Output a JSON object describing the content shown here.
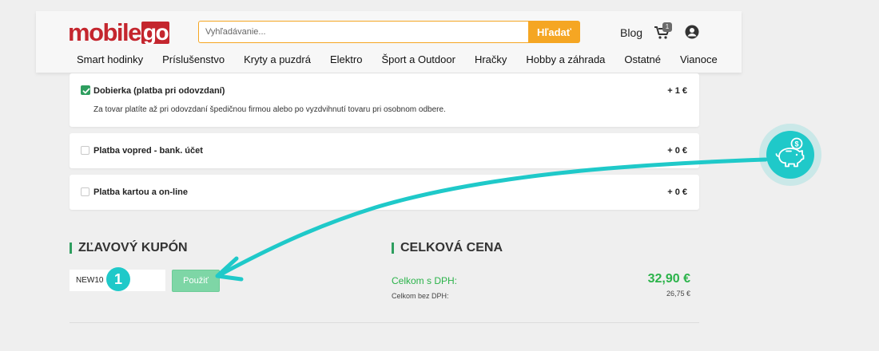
{
  "header": {
    "logo_text": "mobile",
    "logo_box": "go",
    "search_placeholder": "Vyhľadávanie...",
    "search_button": "Hľadať",
    "blog": "Blog",
    "cart_count": "1"
  },
  "nav": [
    "Smart hodinky",
    "Príslušenstvo",
    "Kryty a puzdrá",
    "Elektro",
    "Šport a Outdoor",
    "Hračky",
    "Hobby a záhrada",
    "Ostatné",
    "Vianoce"
  ],
  "payments": [
    {
      "title": "Dobierka (platba pri odovzdaní)",
      "price": "+ 1 €",
      "checked": true,
      "description": "Za tovar platíte až pri odovzdaní špedičnou firmou alebo po vyzdvihnutí tovaru pri osobnom odbere."
    },
    {
      "title": "Platba vopred - bank. účet",
      "price": "+ 0 €",
      "checked": false
    },
    {
      "title": "Platba kartou a on-line",
      "price": "+ 0 €",
      "checked": false
    }
  ],
  "coupon": {
    "heading": "ZĽAVOVÝ KUPÓN",
    "value": "NEW10",
    "button": "Použiť",
    "step": "1"
  },
  "total": {
    "heading": "CELKOVÁ CENA",
    "with_vat_label": "Celkom s DPH:",
    "with_vat_value": "32,90 €",
    "without_vat_label": "Celkom bez DPH:",
    "without_vat_value": "26,75 €"
  },
  "colors": {
    "brand_red": "#c4262e",
    "search_orange": "#f5a623",
    "accent_green": "#2bb34a",
    "annotation_cyan": "#1fc9c9"
  },
  "icons": [
    "cart-icon",
    "user-icon",
    "checkmark-icon",
    "piggy-bank-icon",
    "arrow-annotation"
  ]
}
